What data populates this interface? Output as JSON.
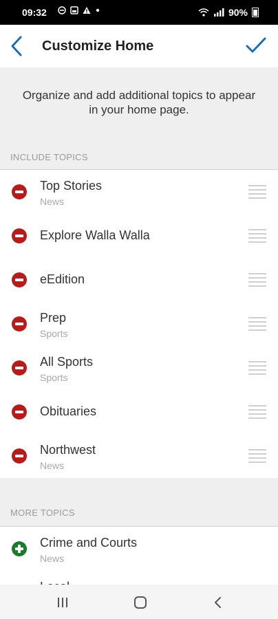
{
  "status_bar": {
    "time": "09:32",
    "battery": "90%"
  },
  "header": {
    "title": "Customize Home",
    "back_icon": "chevron-left-icon",
    "confirm_icon": "checkmark-icon",
    "accent": "#1a6fb3"
  },
  "intro": {
    "message": "Organize and add additional topics to appear in your home page."
  },
  "include_section": {
    "label": "INCLUDE TOPICS",
    "items": [
      {
        "name": "Top Stories",
        "category": "News"
      },
      {
        "name": "Explore Walla Walla",
        "category": ""
      },
      {
        "name": "eEdition",
        "category": ""
      },
      {
        "name": "Prep",
        "category": "Sports"
      },
      {
        "name": "All Sports",
        "category": "Sports"
      },
      {
        "name": "Obituaries",
        "category": ""
      },
      {
        "name": "Northwest",
        "category": "News"
      }
    ]
  },
  "more_section": {
    "label": "MORE TOPICS",
    "items": [
      {
        "name": "Crime and Courts",
        "category": "News"
      },
      {
        "name": "Local",
        "category": ""
      }
    ]
  },
  "colors": {
    "remove": "#b51c1c",
    "add": "#1b7a2b"
  },
  "nav_bar": {
    "recents_icon": "recents-icon",
    "home_icon": "home-icon",
    "back_icon": "back-icon"
  }
}
